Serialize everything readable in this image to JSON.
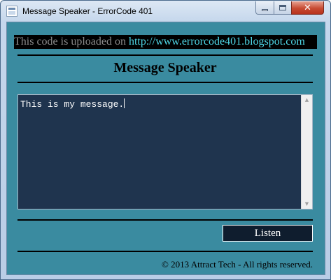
{
  "window": {
    "title": "Message Speaker - ErrorCode 401",
    "controls": {
      "minimize_icon": "minimize-icon",
      "maximize_icon": "maximize-icon",
      "close_icon": "close-icon",
      "close_glyph": "✕"
    }
  },
  "banner": {
    "text": "This code is uploaded on ",
    "link": "http://www.errorcode401.blogspot.com"
  },
  "heading": "Message Speaker",
  "message": {
    "value": "This is my message."
  },
  "scrollbar": {
    "up_glyph": "▲",
    "down_glyph": "▼"
  },
  "listen_button": "Listen",
  "footer": "© 2013 Attract Tech - All rights reserved.",
  "colors": {
    "client_background": "#3a8ba0",
    "textarea_background": "#1f344e",
    "button_background": "#0f1d2e",
    "banner_link": "#4fd6e6",
    "banner_text": "#8c8c8c"
  }
}
